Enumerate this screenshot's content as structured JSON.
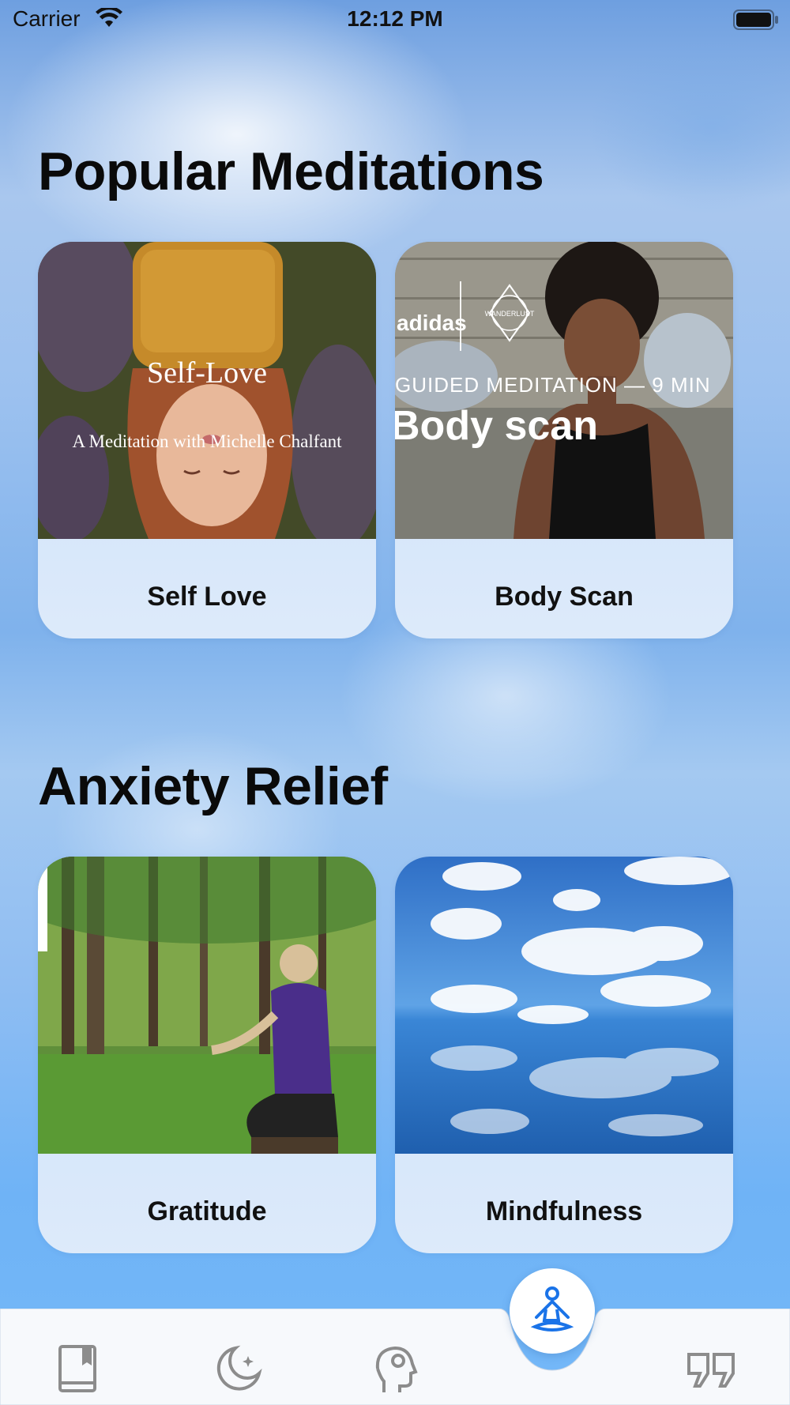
{
  "status_bar": {
    "carrier": "Carrier",
    "time": "12:12 PM"
  },
  "sections": [
    {
      "title": "Popular Meditations",
      "cards": [
        {
          "label": "Self Love",
          "image_title": "Self-Love",
          "image_subtitle": "A Meditation with Michelle Chalfant"
        },
        {
          "label": "Body Scan",
          "brand_left": "adidas",
          "brand_right": "WANDERLUST",
          "image_kicker": "GUIDED MEDITATION — 9 MIN",
          "image_title": "Body scan"
        }
      ]
    },
    {
      "title": "Anxiety Relief",
      "cards": [
        {
          "label": "Gratitude"
        },
        {
          "label": "Mindfulness"
        }
      ]
    }
  ],
  "tab_bar": {
    "items": [
      {
        "icon": "journal-icon"
      },
      {
        "icon": "moon-icon"
      },
      {
        "icon": "mind-gear-icon"
      },
      {
        "icon": "meditation-icon",
        "active": true
      },
      {
        "icon": "quote-icon"
      }
    ],
    "active_color": "#1a73e8",
    "inactive_color": "#8c8c8c"
  }
}
